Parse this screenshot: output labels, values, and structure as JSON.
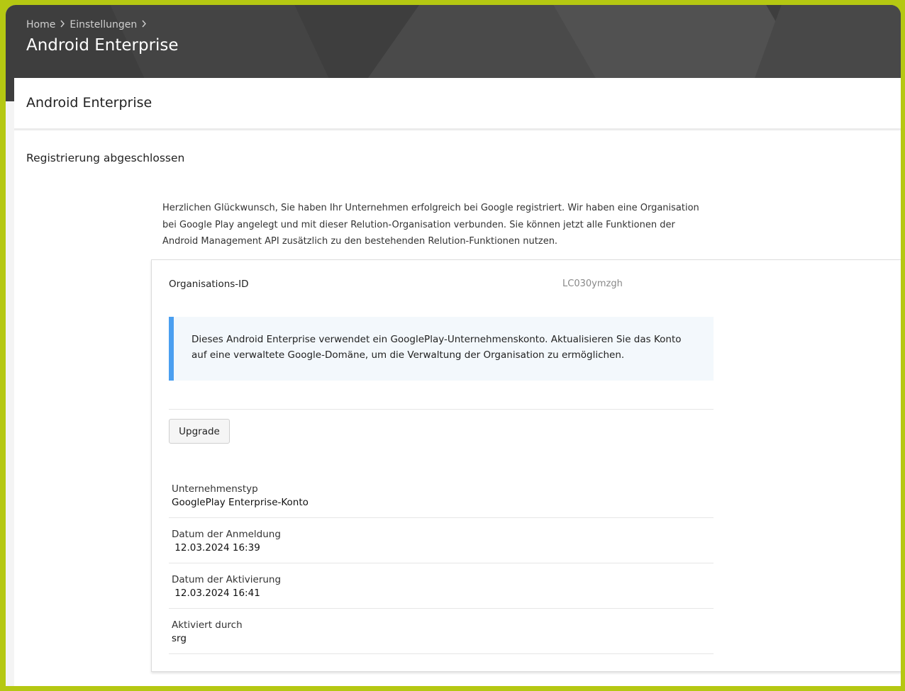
{
  "breadcrumb": {
    "home": "Home",
    "settings": "Einstellungen"
  },
  "header": {
    "title": "Android Enterprise"
  },
  "card": {
    "title": "Android Enterprise",
    "section_title": "Registrierung abgeschlossen",
    "intro": "Herzlichen Glückwunsch, Sie haben Ihr Unternehmen erfolgreich bei Google registriert. Wir haben eine Organisation bei Google Play angelegt und mit dieser Relution-Organisation verbunden. Sie können jetzt alle Funktionen der Android Management API zusätzlich zu den bestehenden Relution-Funktionen nutzen."
  },
  "org": {
    "label": "Organisations-ID",
    "value": "LC030ymzgh"
  },
  "alert": {
    "text": "Dieses Android Enterprise verwendet ein GooglePlay-Unternehmenskonto. Aktualisieren Sie das Konto auf eine verwaltete Google-Domäne, um die Verwaltung der Organisation zu ermöglichen."
  },
  "upgrade_button": "Upgrade",
  "fields": [
    {
      "label": "Unternehmenstyp",
      "value": "GooglePlay Enterprise-Konto"
    },
    {
      "label": "Datum der Anmeldung",
      "value": " 12.03.2024 16:39"
    },
    {
      "label": "Datum der Aktivierung",
      "value": " 12.03.2024 16:41"
    },
    {
      "label": "Aktiviert durch",
      "value": "srg"
    }
  ],
  "colors": {
    "frame": "#b5c812",
    "header": "#3e3e3e",
    "alert_bar": "#4a9ff0",
    "alert_bg": "#f3f8fc"
  },
  "icons": {
    "breadcrumb_separator": "chevron-right-icon"
  }
}
